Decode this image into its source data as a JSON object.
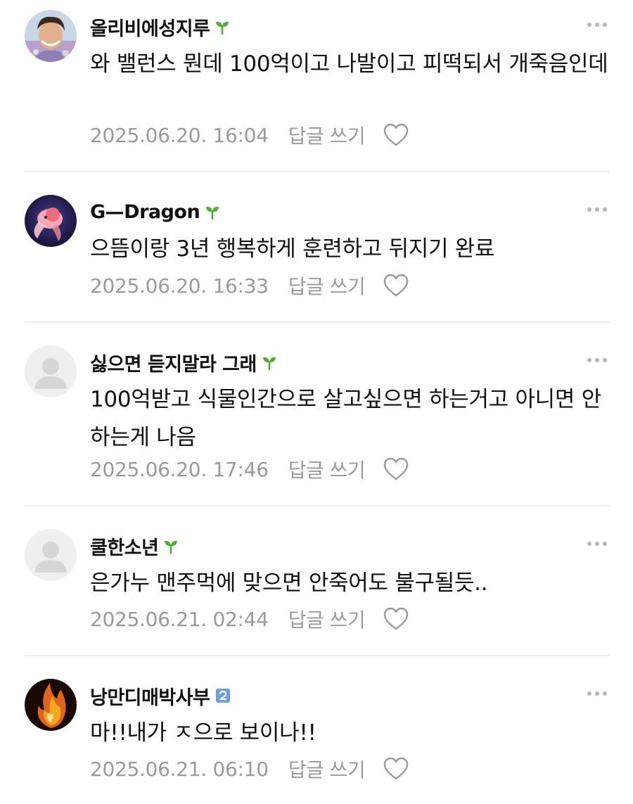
{
  "comments": [
    {
      "nickname": "올리비에성지루",
      "badge": "sprout-icon",
      "avatar": "photo-person-avatar",
      "text": "와 밸런스 뭔데 100억이고 나발이고 피떡되서 개죽음인데",
      "timestamp": "2025.06.20. 16:04",
      "reply_label": "답글 쓰기"
    },
    {
      "nickname": "G—Dragon",
      "badge": "sprout-icon",
      "avatar": "photo-goldfish-avatar",
      "text": "으뜸이랑 3년 행복하게 훈련하고 뒤지기 완료",
      "timestamp": "2025.06.20. 16:33",
      "reply_label": "답글 쓰기"
    },
    {
      "nickname": "싫으면 듣지말라 그래",
      "badge": "sprout-icon",
      "avatar": "default-user-avatar",
      "text": "100억받고 식물인간으로 살고싶으면 하는거고 아니면 안하는게 나음",
      "timestamp": "2025.06.20. 17:46",
      "reply_label": "답글 쓰기"
    },
    {
      "nickname": "쿨한소년",
      "badge": "sprout-icon",
      "avatar": "default-user-avatar",
      "text": "은가누 맨주먹에 맞으면 안죽어도 불구될듯..",
      "timestamp": "2025.06.21. 02:44",
      "reply_label": "답글 쓰기"
    },
    {
      "nickname": "낭만디매박사부",
      "badge": "level-2-icon",
      "level": "2",
      "avatar": "photo-fire-avatar",
      "text": "마!!내가 ㅈ으로 보이나!!",
      "timestamp": "2025.06.21. 06:10",
      "reply_label": "답글 쓰기"
    }
  ],
  "colors": {
    "meta_gray": "#9a9a9a",
    "divider": "#ececec",
    "sprout_green": "#4caf2f",
    "level_blue": "#6f9ee6"
  }
}
